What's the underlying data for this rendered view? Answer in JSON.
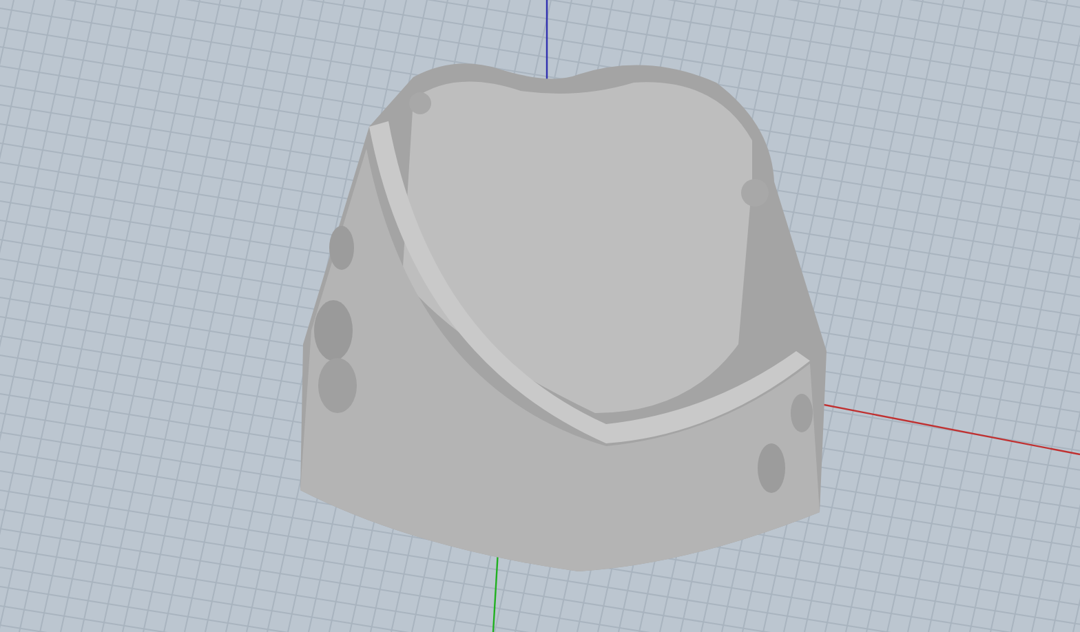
{
  "viewport": {
    "grid_shown": true,
    "axes_shown": true
  }
}
